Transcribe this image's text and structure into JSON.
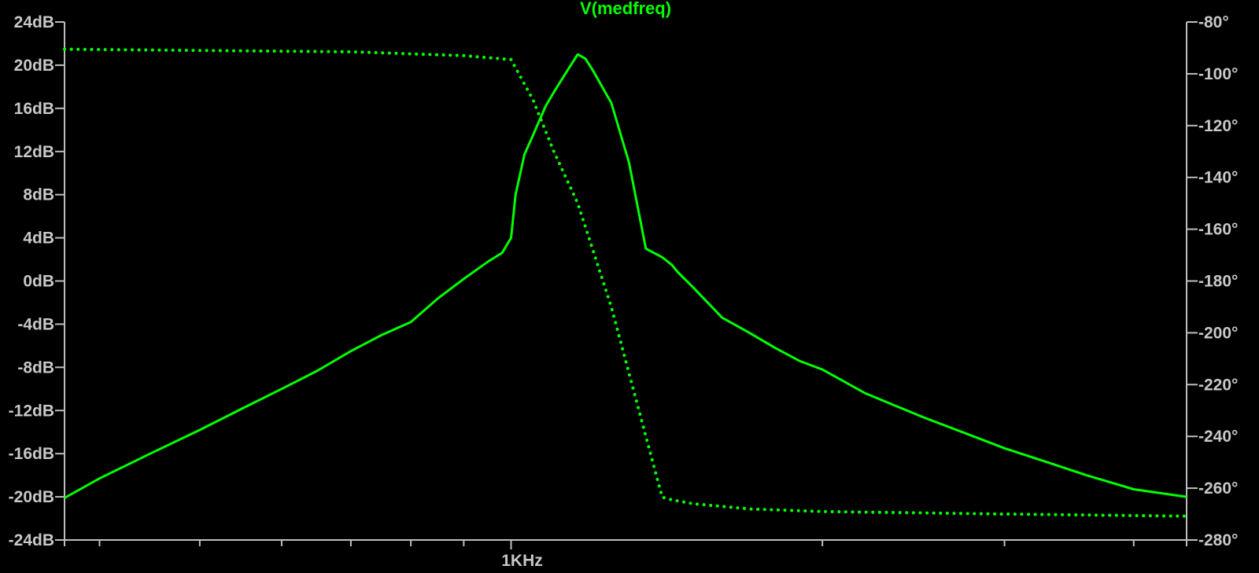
{
  "chart_data": {
    "type": "line",
    "title": "V(medfreq)",
    "xlabel": "",
    "ylabel": "",
    "x_scale": "log",
    "x_unit": "Hz",
    "xlim": [
      370,
      4500
    ],
    "x_tick_labels": [
      {
        "value": 1000,
        "label": "1KHz"
      }
    ],
    "x_minor_ticks": [
      400,
      500,
      600,
      700,
      800,
      900,
      2000,
      3000,
      4000
    ],
    "left_axis": {
      "unit": "dB",
      "ylim": [
        -24,
        24
      ],
      "ticks": [
        24,
        20,
        16,
        12,
        8,
        4,
        0,
        -4,
        -8,
        -12,
        -16,
        -20,
        -24
      ],
      "tick_labels": [
        "24dB",
        "20dB",
        "16dB",
        "12dB",
        "8dB",
        "4dB",
        "0dB",
        "-4dB",
        "-8dB",
        "-12dB",
        "-16dB",
        "-20dB",
        "-24dB"
      ]
    },
    "right_axis": {
      "unit": "°",
      "ylim": [
        -280,
        -80
      ],
      "ticks": [
        -80,
        -100,
        -120,
        -140,
        -160,
        -180,
        -200,
        -220,
        -240,
        -260,
        -280
      ],
      "tick_labels": [
        "-80°",
        "-100°",
        "-120°",
        "-140°",
        "-160°",
        "-180°",
        "-200°",
        "-220°",
        "-240°",
        "-260°",
        "-280°"
      ]
    },
    "grid": false,
    "legend": "none",
    "series": [
      {
        "name": "V(medfreq)",
        "role": "magnitude",
        "axis": "left",
        "style": "solid",
        "color": "#00ff00",
        "x": [
          370,
          400,
          450,
          500,
          550,
          600,
          650,
          700,
          750,
          800,
          850,
          900,
          950,
          980,
          1000,
          1010,
          1030,
          1050,
          1080,
          1100,
          1130,
          1160,
          1180,
          1200,
          1250,
          1300,
          1350,
          1400,
          1430,
          1450,
          1500,
          1600,
          1700,
          1800,
          1900,
          2000,
          2200,
          2500,
          2800,
          3000,
          3300,
          3600,
          4000,
          4500
        ],
        "y": [
          -20.1,
          -18.3,
          -15.9,
          -13.8,
          -11.8,
          -10.0,
          -8.3,
          -6.5,
          -5.0,
          -3.8,
          -1.6,
          0.2,
          1.8,
          2.6,
          4.0,
          8.0,
          11.7,
          13.5,
          16.2,
          17.5,
          19.3,
          21.0,
          20.6,
          19.5,
          16.5,
          11.0,
          3.0,
          2.2,
          1.5,
          0.8,
          -0.6,
          -3.4,
          -4.8,
          -6.2,
          -7.4,
          -8.2,
          -10.4,
          -12.6,
          -14.4,
          -15.5,
          -16.8,
          -18.0,
          -19.3,
          -20.0
        ]
      },
      {
        "name": "phase",
        "role": "phase",
        "axis": "right",
        "style": "dotted",
        "color": "#00ff00",
        "x": [
          370,
          500,
          700,
          900,
          1000,
          1050,
          1100,
          1160,
          1250,
          1350,
          1400,
          1430,
          1500,
          1700,
          2000,
          3000,
          4500
        ],
        "y": [
          -90.5,
          -91.0,
          -91.5,
          -93.0,
          -94.5,
          -110.0,
          -130.0,
          -150.0,
          -190.0,
          -240.0,
          -263.5,
          -264.5,
          -266.0,
          -268.0,
          -269.0,
          -270.0,
          -270.8
        ]
      }
    ]
  }
}
